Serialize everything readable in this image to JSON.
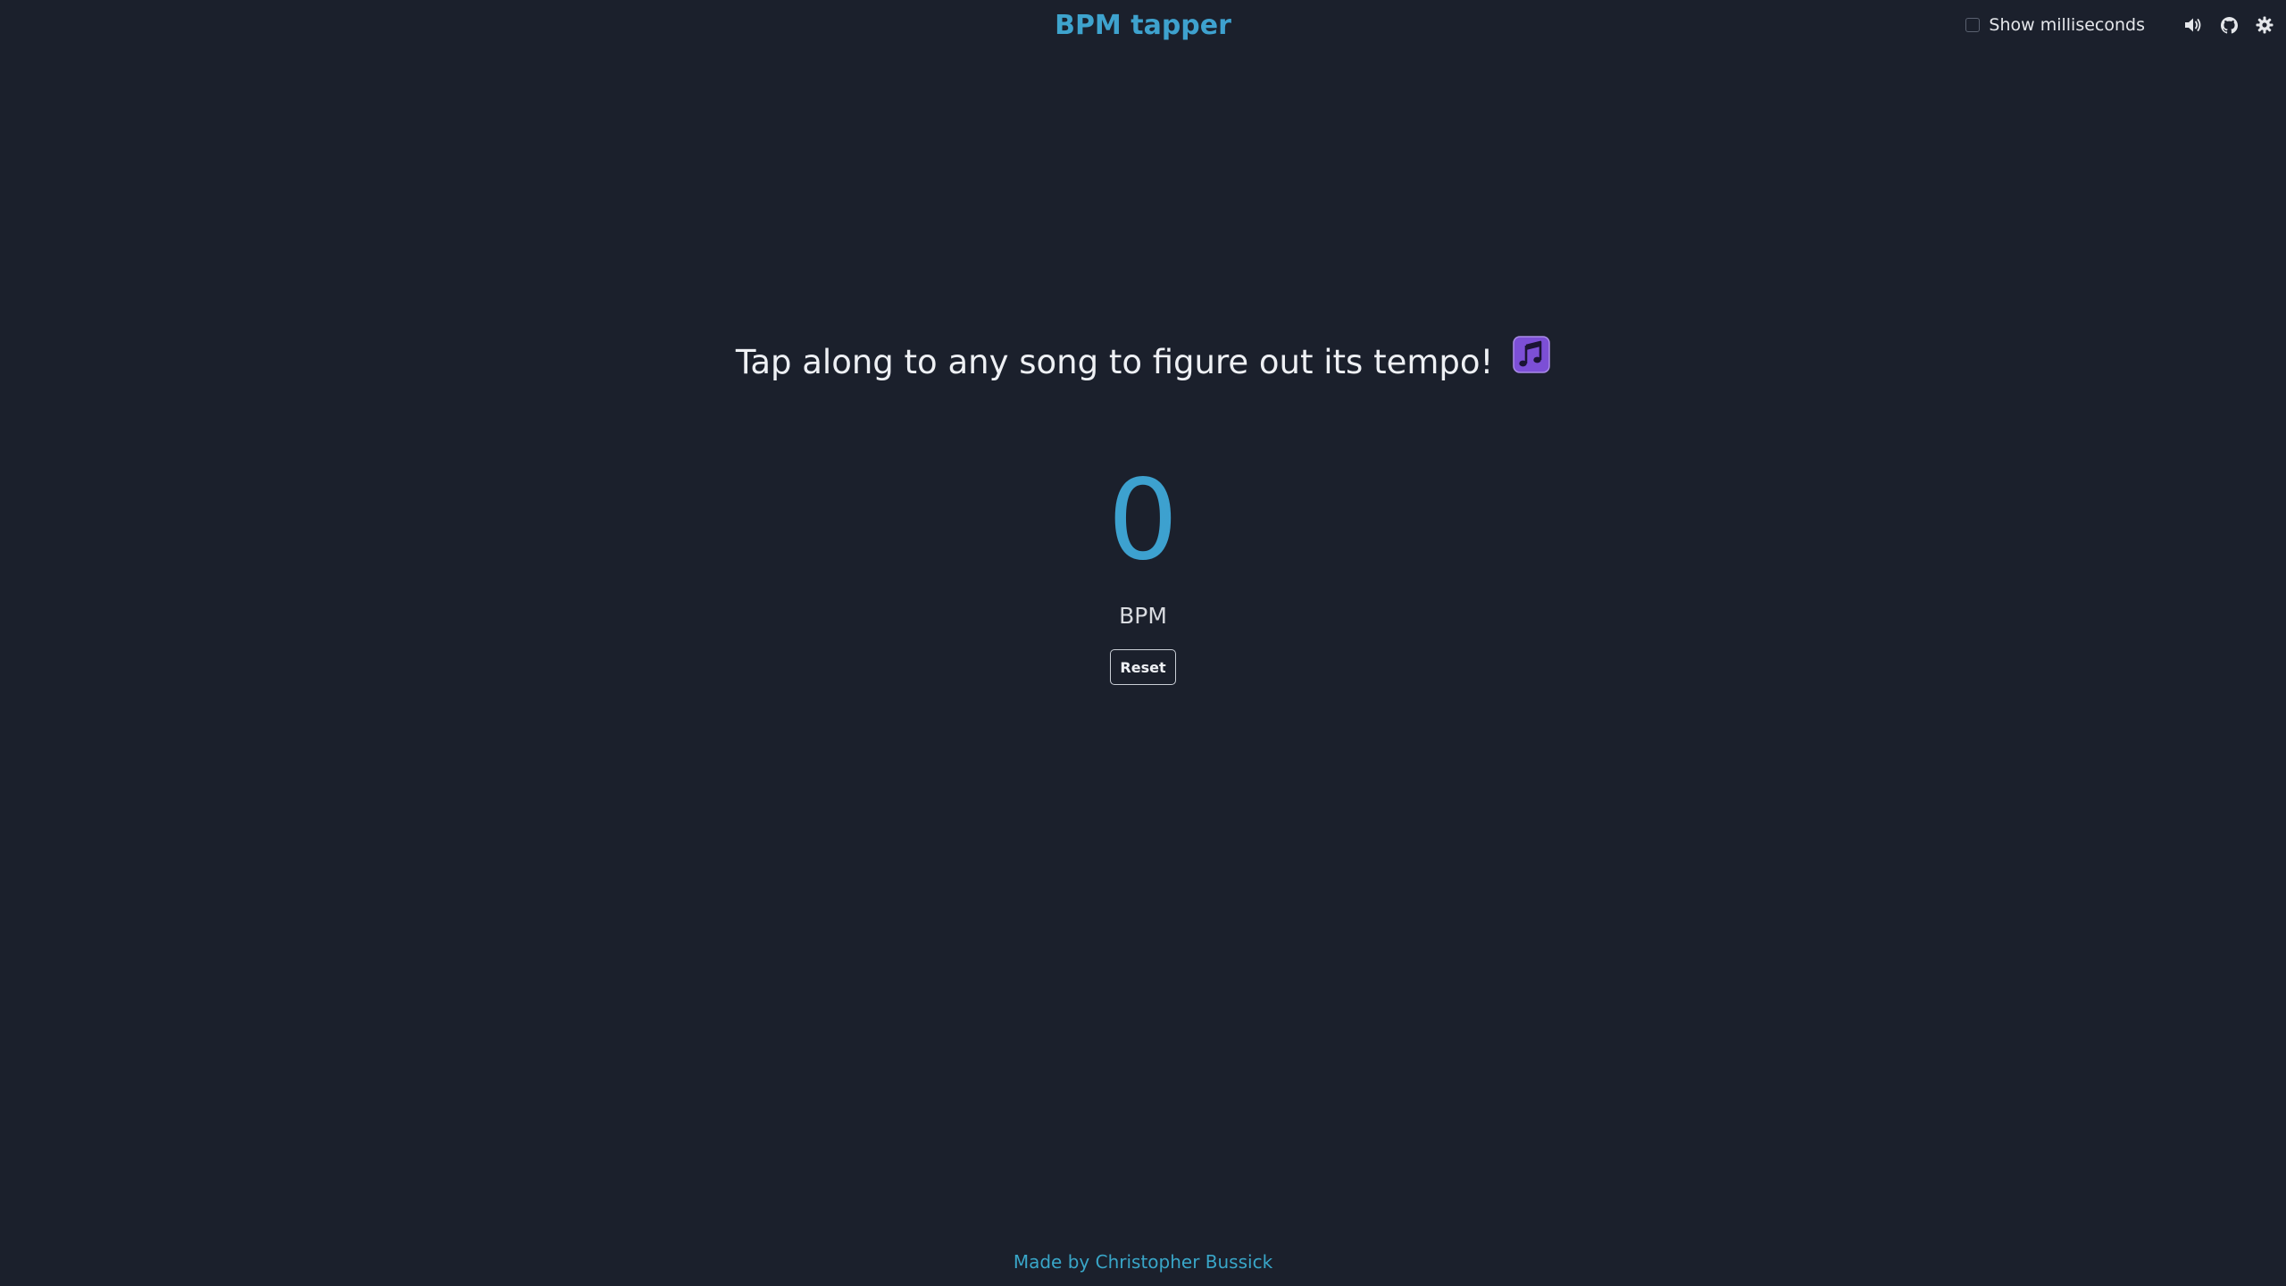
{
  "header": {
    "title": "BPM tapper",
    "show_ms_label": "Show milliseconds",
    "show_ms_checked": false,
    "icons": [
      "volume-icon",
      "github-icon",
      "settings-icon"
    ]
  },
  "main": {
    "tagline": "Tap along to any song to figure out its tempo!",
    "tagline_emoji": "music-notes-icon",
    "bpm_value": "0",
    "bpm_unit": "BPM",
    "reset_label": "Reset"
  },
  "footer": {
    "prefix": "Made by ",
    "author": "Christopher Bussick"
  },
  "colors": {
    "background": "#1b202c",
    "accent": "#3ea4ca",
    "text": "#eef0f4",
    "emoji_purple": "#8b5cf6"
  }
}
